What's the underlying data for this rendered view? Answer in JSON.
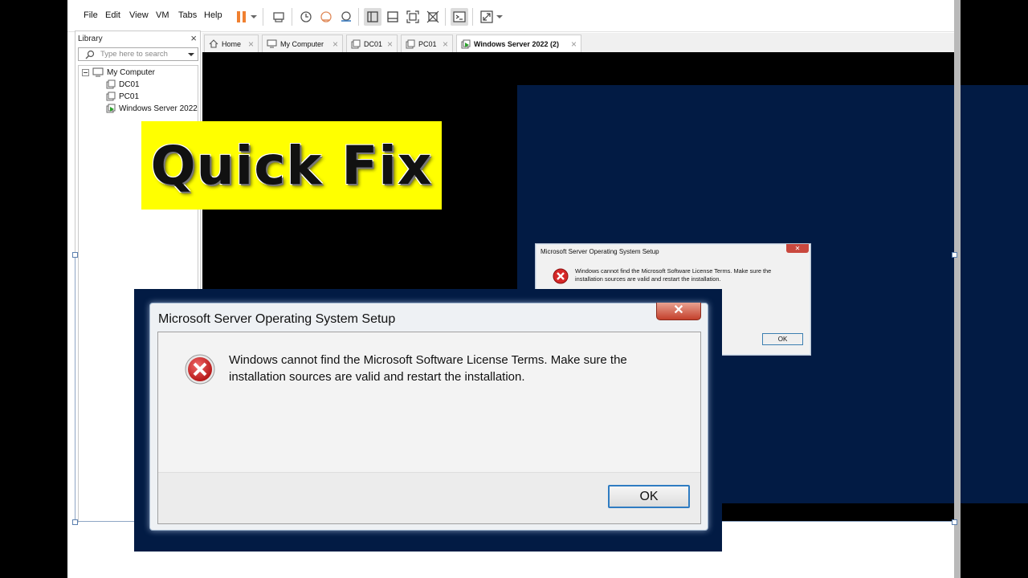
{
  "menubar": {
    "items": [
      "File",
      "Edit",
      "View",
      "VM",
      "Tabs",
      "Help"
    ]
  },
  "toolbar": {
    "icons": [
      "pause-icon",
      "dropdown-icon",
      "send-keys-icon",
      "snapshot-icon",
      "revert-snapshot-icon",
      "snapshot-manager-icon",
      "library-view-icon",
      "thumbnail-view-icon",
      "full-screen-icon",
      "unity-icon",
      "console-icon",
      "stretch-icon",
      "dropdown-icon"
    ],
    "accent": "#f08030"
  },
  "library": {
    "title": "Library",
    "close": "×",
    "search_placeholder": "Type here to search",
    "tree": {
      "root": "My Computer",
      "children": [
        "DC01",
        "PC01",
        "Windows Server 2022"
      ]
    }
  },
  "tabs": [
    {
      "label": "Home",
      "close": "×"
    },
    {
      "label": "My Computer",
      "close": "×"
    },
    {
      "label": "DC01",
      "close": "×"
    },
    {
      "label": "PC01",
      "close": "×"
    },
    {
      "label": "Windows Server 2022 (2)",
      "close": "×",
      "active": true
    }
  ],
  "banner": {
    "text": "Quick Fix",
    "background": "#ffff00"
  },
  "small_dialog": {
    "title": "Microsoft Server Operating System Setup",
    "close": "✕",
    "message": "Windows cannot find the Microsoft Software License Terms. Make sure the installation sources are valid and restart the installation.",
    "ok": "OK"
  },
  "big_dialog": {
    "title": "Microsoft Server Operating System Setup",
    "close": "✕",
    "message": "Windows cannot find the Microsoft Software License Terms. Make sure the installation sources are valid and restart the installation.",
    "ok": "OK"
  },
  "colors": {
    "vm_background": "#021b44",
    "error_red": "#d62828"
  }
}
